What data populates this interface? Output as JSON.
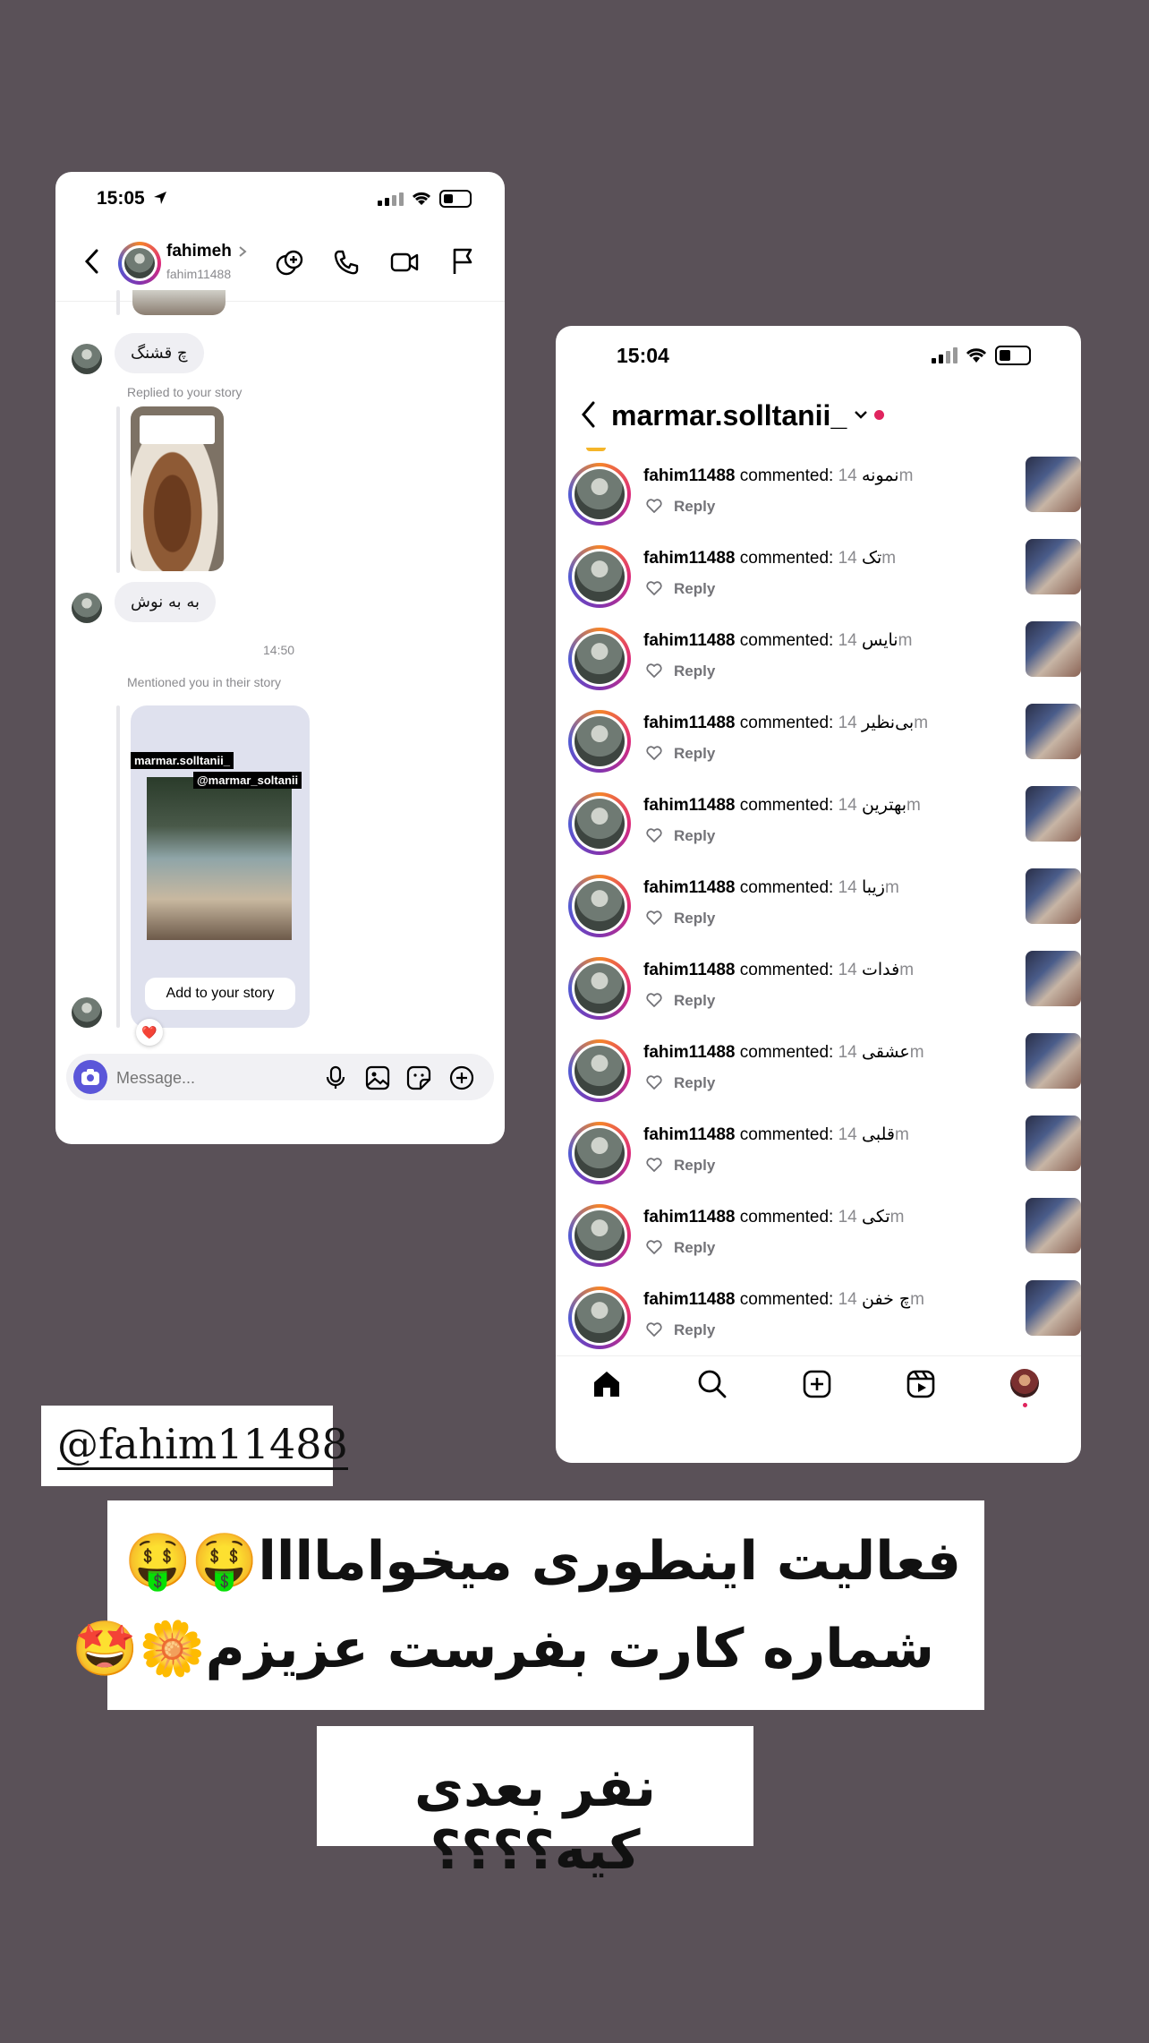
{
  "dm": {
    "status_time": "15:05",
    "contact_name": "fahimeh",
    "contact_username": "fahim11488",
    "messages": [
      {
        "text": "چ قشنگ"
      },
      {
        "text": "به به نوش"
      }
    ],
    "replied_label": "Replied to your story",
    "timestamp": "14:50",
    "mentioned_label": "Mentioned you in their story",
    "story_tag_top": "marmar.solltanii_",
    "story_tag_mention": "@marmar_soltanii",
    "add_to_story": "Add to your story",
    "reaction": "❤️",
    "message_placeholder": "Message..."
  },
  "notif": {
    "status_time": "15:04",
    "title": "marmar.solltanii_",
    "chevron": "⌄",
    "reply_label": "Reply",
    "items": [
      {
        "user": "fahim11488",
        "action": "commented:",
        "comment": "نمونه",
        "time": "14m"
      },
      {
        "user": "fahim11488",
        "action": "commented:",
        "comment": "تک",
        "time": "14m"
      },
      {
        "user": "fahim11488",
        "action": "commented:",
        "comment": "نایس",
        "time": "14m"
      },
      {
        "user": "fahim11488",
        "action": "commented:",
        "comment": "بی‌نظیر",
        "time": "14m"
      },
      {
        "user": "fahim11488",
        "action": "commented:",
        "comment": "بهترین",
        "time": "14m"
      },
      {
        "user": "fahim11488",
        "action": "commented:",
        "comment": "زیبا",
        "time": "14m"
      },
      {
        "user": "fahim11488",
        "action": "commented:",
        "comment": "فدات",
        "time": "14m"
      },
      {
        "user": "fahim11488",
        "action": "commented:",
        "comment": "عشقی",
        "time": "14m"
      },
      {
        "user": "fahim11488",
        "action": "commented:",
        "comment": "قلبی",
        "time": "14m"
      },
      {
        "user": "fahim11488",
        "action": "commented:",
        "comment": "تکی",
        "time": "14m"
      },
      {
        "user": "fahim11488",
        "action": "commented:",
        "comment": "چ خفن",
        "time": "14m"
      }
    ]
  },
  "story": {
    "handle": "@fahim11488",
    "message_line1": "فعالیت اینطوری میخواماااا🤑🤑",
    "message_line2": "شماره کارت بفرست عزیزم🌼🤩",
    "next_person": "نفر بعدی کیه؟؟؟؟"
  },
  "colors": {
    "background": "#5a5158",
    "accent_blue": "#5b56d9",
    "notification_dot": "#e0245e"
  }
}
